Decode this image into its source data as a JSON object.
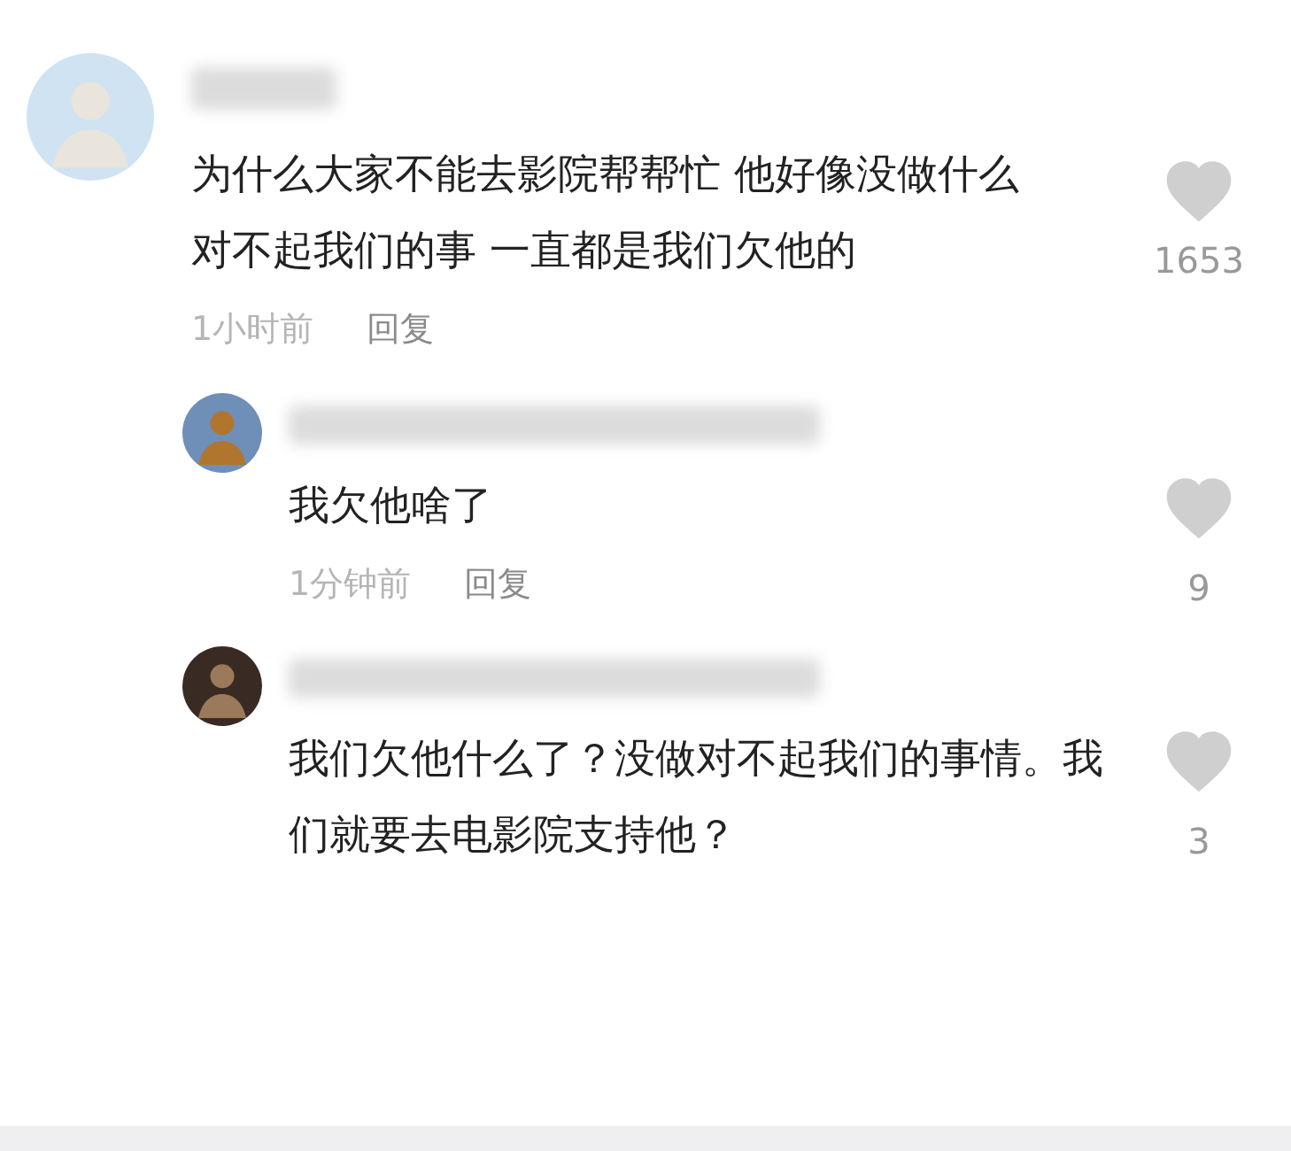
{
  "comments": [
    {
      "text": "为什么大家不能去影院帮帮忙 他好像没做什么对不起我们的事 一直都是我们欠他的",
      "time": "1小时前",
      "reply": "回复",
      "likes": "1653",
      "children": [
        {
          "text": "我欠他啥了",
          "time": "1分钟前",
          "reply": "回复",
          "likes": "9"
        },
        {
          "text": "我们欠他什么了？没做对不起我们的事情。我们就要去电影院支持他？",
          "likes": "3"
        }
      ]
    }
  ]
}
